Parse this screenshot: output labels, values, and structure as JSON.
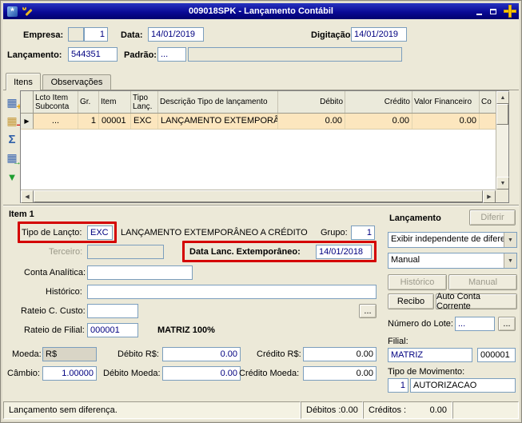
{
  "colors": {
    "titlebar": "#0A0A96",
    "field_text": "#000080",
    "selected_row": "#FCE6BE",
    "annotation": "#D40000",
    "plus_icon": "#FFCC00"
  },
  "window": {
    "title": "009018SPK - Lançamento Contábil"
  },
  "header": {
    "empresa_label": "Empresa:",
    "empresa_value": "1",
    "data_label": "Data:",
    "data_value": "14/01/2019",
    "digitacao_label": "Digitação:",
    "digitacao_value": "14/01/2019",
    "lancamento_label": "Lançamento:",
    "lancamento_value": "544351",
    "padrao_label": "Padrão:",
    "padrao_value": "..."
  },
  "tabs": [
    {
      "label": "Itens"
    },
    {
      "label": "Observações"
    }
  ],
  "grid": {
    "columns": [
      "Lcto Item Subconta",
      "Gr.",
      "Item",
      "Tipo Lanç.",
      "Descrição Tipo de lançamento",
      "Débito",
      "Crédito",
      "Valor Financeiro",
      "Co"
    ],
    "row": {
      "subconta": "...",
      "gr": "1",
      "item": "00001",
      "tipo_lanc": "EXC",
      "descricao": "LANÇAMENTO EXTEMPORÂNE",
      "debito": "0.00",
      "credito": "0.00",
      "valor_financeiro": "0.00"
    }
  },
  "item": {
    "title": "Item 1",
    "tipo_lancto_label": "Tipo de Lançto:",
    "tipo_lancto_value": "EXC",
    "tipo_lancto_desc": "LANÇAMENTO EXTEMPORÂNEO A CRÉDITO",
    "grupo_label": "Grupo:",
    "grupo_value": "1",
    "terceiro_label": "Terceiro:",
    "data_ext_label": "Data Lanc. Extemporâneo:",
    "data_ext_value": "14/01/2018",
    "conta_analitica_label": "Conta Analítica:",
    "historico_label": "Histórico:",
    "rateio_custo_label": "Rateio C. Custo:",
    "rateio_custo_button": "...",
    "rateio_filial_label": "Rateio de Filial:",
    "rateio_filial_value": "000001",
    "rateio_filial_desc": "MATRIZ 100%",
    "moeda_label": "Moeda:",
    "moeda_value": "R$",
    "debito_rs_label": "Débito R$:",
    "debito_rs_value": "0.00",
    "credito_rs_label": "Crédito R$:",
    "credito_rs_value": "0.00",
    "cambio_label": "Câmbio:",
    "cambio_value": "1.00000",
    "debito_moeda_label": "Débito Moeda:",
    "debito_moeda_value": "0.00",
    "credito_moeda_label": "Crédito Moeda:",
    "credito_moeda_value": "0.00"
  },
  "lancamento_panel": {
    "title": "Lançamento",
    "diferir_button": "Diferir",
    "exibir_combo_value": "Exibir independente de difere",
    "modo_combo_value": "Manual",
    "historico_button": "Histórico",
    "manual_button": "Manual",
    "recibo_button": "Recibo",
    "auto_cc_button": "Auto Conta Corrente",
    "lote_label": "Número do Lote:",
    "lote_value": "...",
    "lote_button": "...",
    "filial_label": "Filial:",
    "filial_value": "MATRIZ",
    "filial_code": "000001",
    "tipo_mov_label": "Tipo de Movimento:",
    "tipo_mov_value": "1",
    "tipo_mov_desc": "AUTORIZACAO"
  },
  "statusbar": {
    "message": "Lançamento sem diferença.",
    "debitos_label": "Débitos :",
    "debitos_value": "0.00",
    "creditos_label": "Créditos :",
    "creditos_value": "0.00"
  },
  "icons": {
    "grid": "▦",
    "plus": "+",
    "minus": "−",
    "sigma": "Σ",
    "arrow_right": "→",
    "down_triangle": "▼",
    "up_triangle": "▲",
    "left_triangle": "◀",
    "right_triangle": "▶",
    "row_marker": "▶",
    "dropdown": "▼"
  }
}
